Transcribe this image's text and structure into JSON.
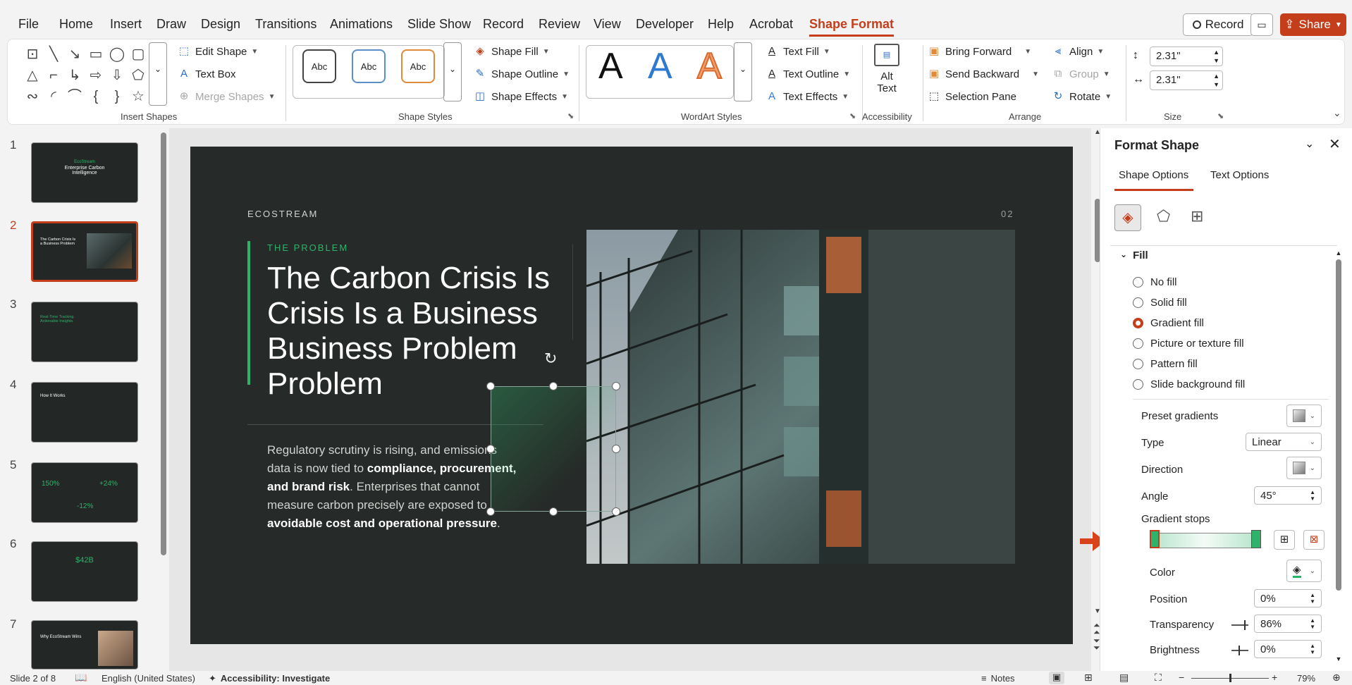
{
  "menu": {
    "tabs": [
      "File",
      "Home",
      "Insert",
      "Draw",
      "Design",
      "Transitions",
      "Animations",
      "Slide Show",
      "Record",
      "Review",
      "View",
      "Developer",
      "Help",
      "Acrobat",
      "Shape Format"
    ],
    "record_label": "Record",
    "share_label": "Share"
  },
  "ribbon": {
    "insert_shapes": {
      "edit_shape": "Edit Shape",
      "text_box": "Text Box",
      "merge_shapes": "Merge Shapes",
      "label": "Insert Shapes"
    },
    "shape_styles": {
      "abc": "Abc",
      "fill": "Shape Fill",
      "outline": "Shape Outline",
      "effects": "Shape Effects",
      "label": "Shape Styles"
    },
    "wordart": {
      "a": "A",
      "text_fill": "Text Fill",
      "text_outline": "Text Outline",
      "text_effects": "Text Effects",
      "label": "WordArt Styles"
    },
    "accessibility": {
      "alt_text_1": "Alt",
      "alt_text_2": "Text",
      "label": "Accessibility"
    },
    "arrange": {
      "bring_forward": "Bring Forward",
      "send_backward": "Send Backward",
      "selection_pane": "Selection Pane",
      "align": "Align",
      "group": "Group",
      "rotate": "Rotate",
      "label": "Arrange"
    },
    "size": {
      "height": "2.31\"",
      "width": "2.31\"",
      "label": "Size"
    }
  },
  "thumbnails": [
    {
      "num": "1",
      "brand": "EcoStream",
      "title": "Enterprise Carbon Intelligence"
    },
    {
      "num": "2",
      "title": "The Carbon Crisis Is a Business Problem"
    },
    {
      "num": "3",
      "title": "Real-Time Tracking. Actionable Insights."
    },
    {
      "num": "4",
      "title": "How It Works"
    },
    {
      "num": "5",
      "stat1": "150%",
      "stat2": "+24%",
      "stat3": "-12%"
    },
    {
      "num": "6",
      "stat": "$42B"
    },
    {
      "num": "7",
      "title": "Why EcoStream Wins"
    }
  ],
  "slide": {
    "brand": "ECOSTREAM",
    "page": "02",
    "eyebrow": "THE PROBLEM",
    "title_lines": [
      "The Carbon Crisis Is",
      "Crisis Is a Business",
      "Business Problem",
      "Problem"
    ],
    "body_1": "Regulatory scrutiny is rising, and emissions",
    "body_2a": "data is now tied to ",
    "body_2b": "compliance, procurement,",
    "body_3a": "and brand risk",
    "body_3b": ". Enterprises that cannot",
    "body_4": "measure carbon precisely are exposed to",
    "body_5a": "avoidable cost and operational pressure",
    "body_5b": "."
  },
  "pane": {
    "title": "Format Shape",
    "tab_shape": "Shape Options",
    "tab_text": "Text Options",
    "section": "Fill",
    "fill_options": [
      "No fill",
      "Solid fill",
      "Gradient fill",
      "Picture or texture fill",
      "Pattern fill",
      "Slide background fill"
    ],
    "selected_fill": "Gradient fill",
    "preset_gradients": "Preset gradients",
    "type_label": "Type",
    "type_value": "Linear",
    "direction": "Direction",
    "angle_label": "Angle",
    "angle_value": "45°",
    "gradient_stops": "Gradient stops",
    "color": "Color",
    "position_label": "Position",
    "position_value": "0%",
    "transparency_label": "Transparency",
    "transparency_value": "86%",
    "brightness_label": "Brightness",
    "brightness_value": "0%",
    "accent": "#2fb36a"
  },
  "status": {
    "slide": "Slide 2 of 8",
    "language": "English (United States)",
    "accessibility": "Accessibility: Investigate",
    "notes": "Notes",
    "zoom": "79%"
  }
}
